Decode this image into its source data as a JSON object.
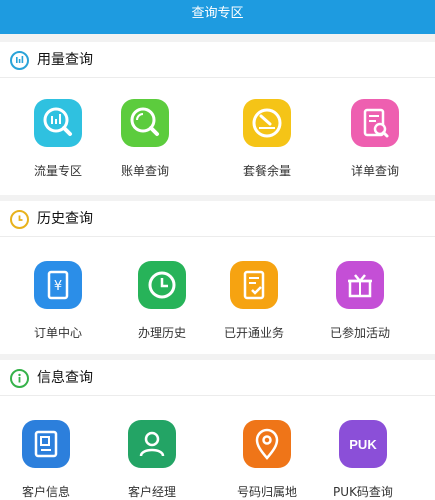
{
  "header": {
    "title": "查询专区"
  },
  "sections": [
    {
      "title": "用量查询",
      "icon": "bar-chart-circle-icon",
      "icon_color": "#2aa3d8",
      "items": [
        {
          "label": "流量专区",
          "icon": "data-chart-search-icon",
          "color": "#2fc1e0"
        },
        {
          "label": "账单查询",
          "icon": "search-magnifier-icon",
          "color": "#5ccc3d"
        },
        {
          "label": "套餐余量",
          "icon": "gauge-icon",
          "color": "#f5c417"
        },
        {
          "label": "详单查询",
          "icon": "document-search-icon",
          "color": "#ee5fb0"
        }
      ]
    },
    {
      "title": "历史查询",
      "icon": "clock-circle-icon",
      "icon_color": "#e8b21c",
      "items": [
        {
          "label": "订单中心",
          "icon": "yuan-receipt-icon",
          "color": "#2b8ee8"
        },
        {
          "label": "办理历史",
          "icon": "clock-history-icon",
          "color": "#27b359"
        },
        {
          "label": "已开通业务",
          "icon": "document-check-icon",
          "color": "#f6a311"
        },
        {
          "label": "已参加活动",
          "icon": "gift-box-icon",
          "color": "#c44fd6"
        }
      ]
    },
    {
      "title": "信息查询",
      "icon": "info-circle-icon",
      "icon_color": "#36b24a",
      "items": [
        {
          "label": "客户信息",
          "icon": "id-card-icon",
          "color": "#2c7fdc"
        },
        {
          "label": "客户经理",
          "icon": "user-icon",
          "color": "#23a465"
        },
        {
          "label": "号码归属地",
          "icon": "location-pin-icon",
          "color": "#ef7518"
        },
        {
          "label": "PUK码查询",
          "icon": "puk-badge-icon",
          "color": "#8b4fd8",
          "badge_text": "PUK"
        }
      ]
    }
  ]
}
